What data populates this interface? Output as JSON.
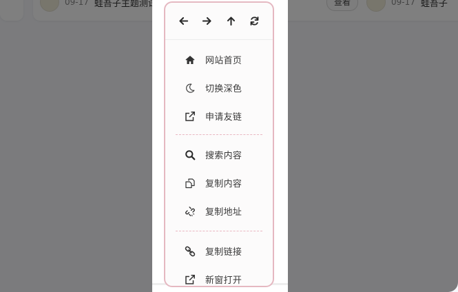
{
  "background": {
    "item_date": "09-17",
    "item_title": "蛙吾子主题测试",
    "item_date_2": "09-17",
    "item_title_2": "蛙吾子",
    "view_button": "查看"
  },
  "menu": {
    "nav": [
      {
        "name": "back",
        "icon": "arrow-left-icon"
      },
      {
        "name": "forward",
        "icon": "arrow-right-icon"
      },
      {
        "name": "up",
        "icon": "arrow-up-icon"
      },
      {
        "name": "refresh",
        "icon": "refresh-icon"
      }
    ],
    "groups": [
      [
        {
          "label": "网站首页",
          "icon": "home-icon"
        },
        {
          "label": "切换深色",
          "icon": "moon-icon"
        },
        {
          "label": "申请友链",
          "icon": "external-link-icon"
        }
      ],
      [
        {
          "label": "搜索内容",
          "icon": "search-icon"
        },
        {
          "label": "复制内容",
          "icon": "copy-icon"
        },
        {
          "label": "复制地址",
          "icon": "unlink-icon"
        }
      ],
      [
        {
          "label": "复制链接",
          "icon": "link-icon"
        },
        {
          "label": "新窗打开",
          "icon": "external-link-icon"
        }
      ]
    ],
    "border_color": "#e5b8c1",
    "separator_color": "#e9b6c1"
  },
  "overlay_color": "rgba(0,0,0,0.5)"
}
